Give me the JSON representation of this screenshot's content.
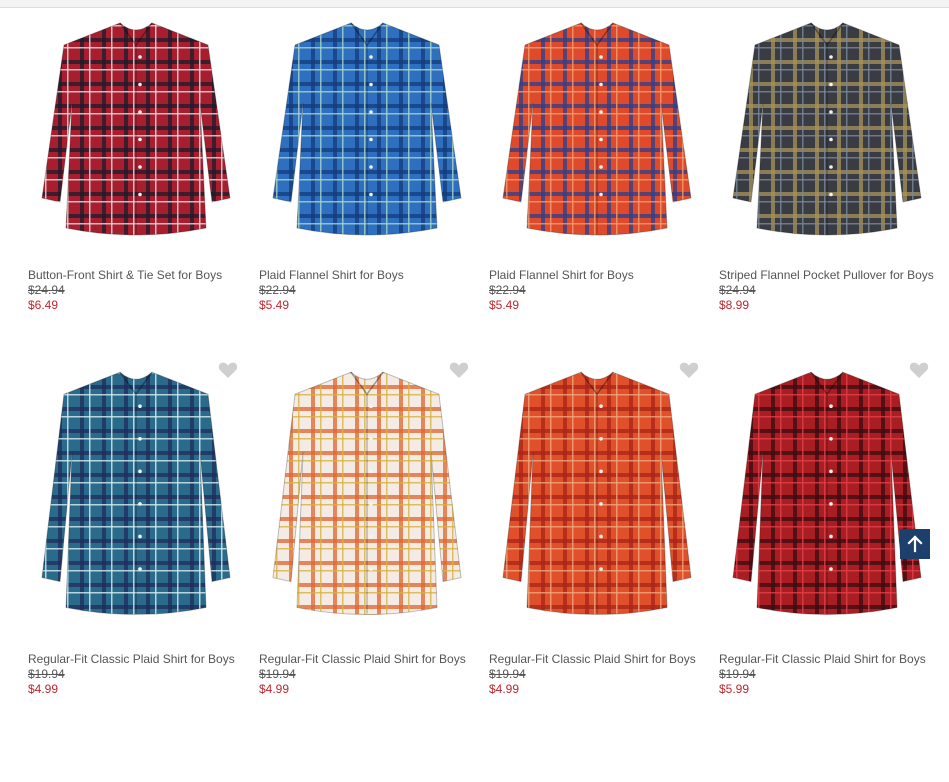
{
  "products": [
    {
      "name": "Button-Front Shirt & Tie Set for Boys",
      "was": "$24.94",
      "now": "$6.49",
      "image": "red-plaid-shirt-with-tie",
      "favorite": false,
      "colors": {
        "base": "#a81e2f",
        "line": "#1b1b2a",
        "accent": "#e6e6e6"
      }
    },
    {
      "name": "Plaid Flannel Shirt for Boys",
      "was": "$22.94",
      "now": "$5.49",
      "image": "blue-plaid-flannel-shirt",
      "favorite": false,
      "colors": {
        "base": "#2f6fbf",
        "line": "#123a7a",
        "accent": "#a9d8c8"
      }
    },
    {
      "name": "Plaid Flannel Shirt for Boys",
      "was": "$22.94",
      "now": "$5.49",
      "image": "boy-red-plaid-flannel",
      "favorite": false,
      "colors": {
        "base": "#e04a2c",
        "line": "#2a3f8a",
        "accent": "#f0a070"
      }
    },
    {
      "name": "Striped Flannel Pocket Pullover for Boys",
      "was": "$24.94",
      "now": "$8.99",
      "image": "boy-striped-pullover",
      "favorite": false,
      "colors": {
        "base": "#3a3c44",
        "line": "#a8925a",
        "accent": "#7a8a9a"
      }
    },
    {
      "name": "Regular-Fit Classic Plaid Shirt for Boys",
      "was": "$19.94",
      "now": "$4.99",
      "image": "teal-plaid-shirt",
      "favorite": true,
      "colors": {
        "base": "#2a6a8a",
        "line": "#1d2d5a",
        "accent": "#d8f0f4"
      }
    },
    {
      "name": "Regular-Fit Classic Plaid Shirt for Boys",
      "was": "$19.94",
      "now": "$4.99",
      "image": "boy-white-orange-plaid",
      "favorite": true,
      "colors": {
        "base": "#f4ece4",
        "line": "#e0642c",
        "accent": "#d8b040"
      }
    },
    {
      "name": "Regular-Fit Classic Plaid Shirt for Boys",
      "was": "$19.94",
      "now": "$4.99",
      "image": "orange-red-plaid-shirt",
      "favorite": true,
      "colors": {
        "base": "#e0502a",
        "line": "#a82418",
        "accent": "#f0a880"
      }
    },
    {
      "name": "Regular-Fit Classic Plaid Shirt for Boys",
      "was": "$19.94",
      "now": "$5.99",
      "image": "red-gingham-shirt",
      "favorite": true,
      "colors": {
        "base": "#a81e22",
        "line": "#3a0a10",
        "accent": "#e04048"
      }
    }
  ],
  "ui": {
    "favorite_icon": "heart-icon",
    "back_to_top_icon": "arrow-up-icon",
    "back_to_top_color": "#1d3f6b",
    "price_sale_color": "#c0262d"
  }
}
